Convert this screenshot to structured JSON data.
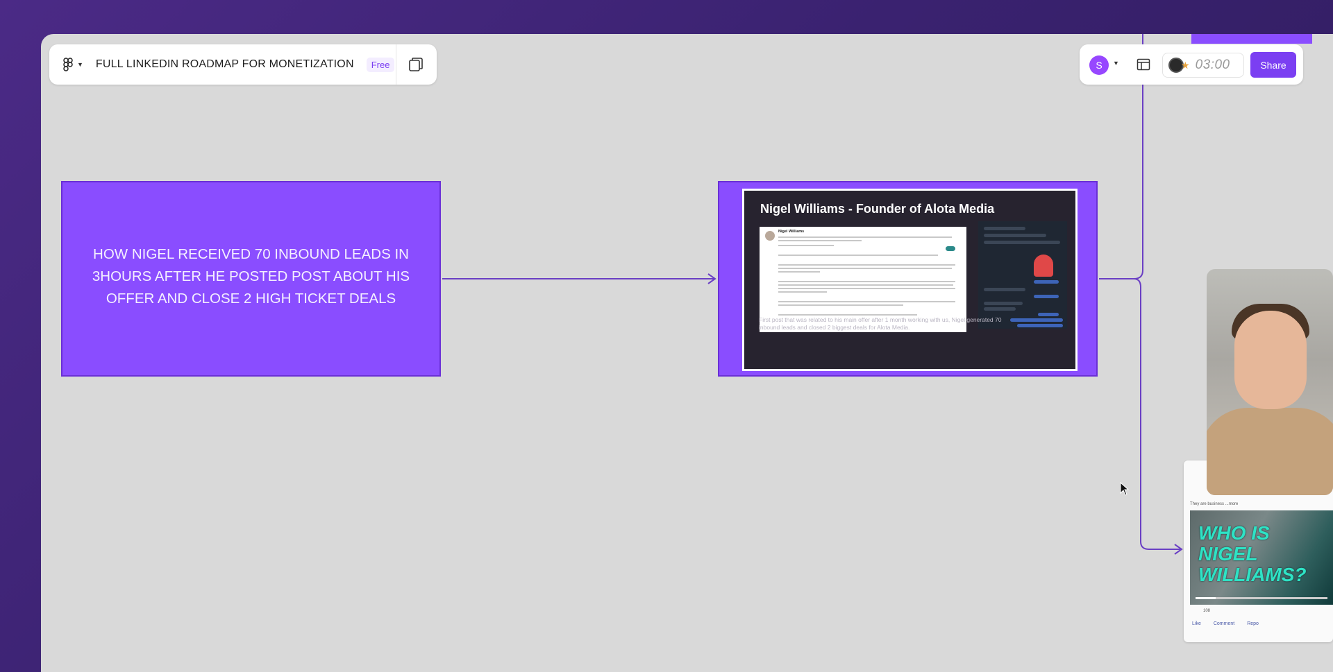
{
  "toolbar": {
    "file_title": "FULL LINKEDIN ROADMAP FOR MONETIZATION",
    "plan_badge": "Free",
    "user_avatar_initial": "S",
    "timer": "03:00",
    "share_label": "Share"
  },
  "canvas": {
    "left_card": {
      "text": "HOW NIGEL RECEIVED 70 INBOUND LEADS IN 3HOURS AFTER HE POSTED POST ABOUT HIS OFFER AND CLOSE 2 HIGH TICKET DEALS"
    },
    "mid_card": {
      "title": "Nigel Williams - Founder of Alota Media",
      "post_author": "Nigel Williams",
      "caption": "First post that was related to his main offer after 1 month working with us, Nigel generated 70 inbound leads and closed 2 biggest deals for Alota Media."
    },
    "right_card": {
      "post_snippet": "They are business ...more",
      "video_title": "WHO IS NIGEL WILLIAMS?",
      "reaction_count": "108",
      "actions": [
        "Like",
        "Comment",
        "Repo"
      ]
    }
  },
  "colors": {
    "accent": "#7b3ff2",
    "card_fill": "#8a4dff",
    "canvas_bg": "#d9d9d9",
    "connector": "#6a3fc4"
  },
  "icons": [
    "figma-menu-icon",
    "chevron-down-icon",
    "pages-icon",
    "layout-icon",
    "star-icon",
    "cursor-icon"
  ]
}
